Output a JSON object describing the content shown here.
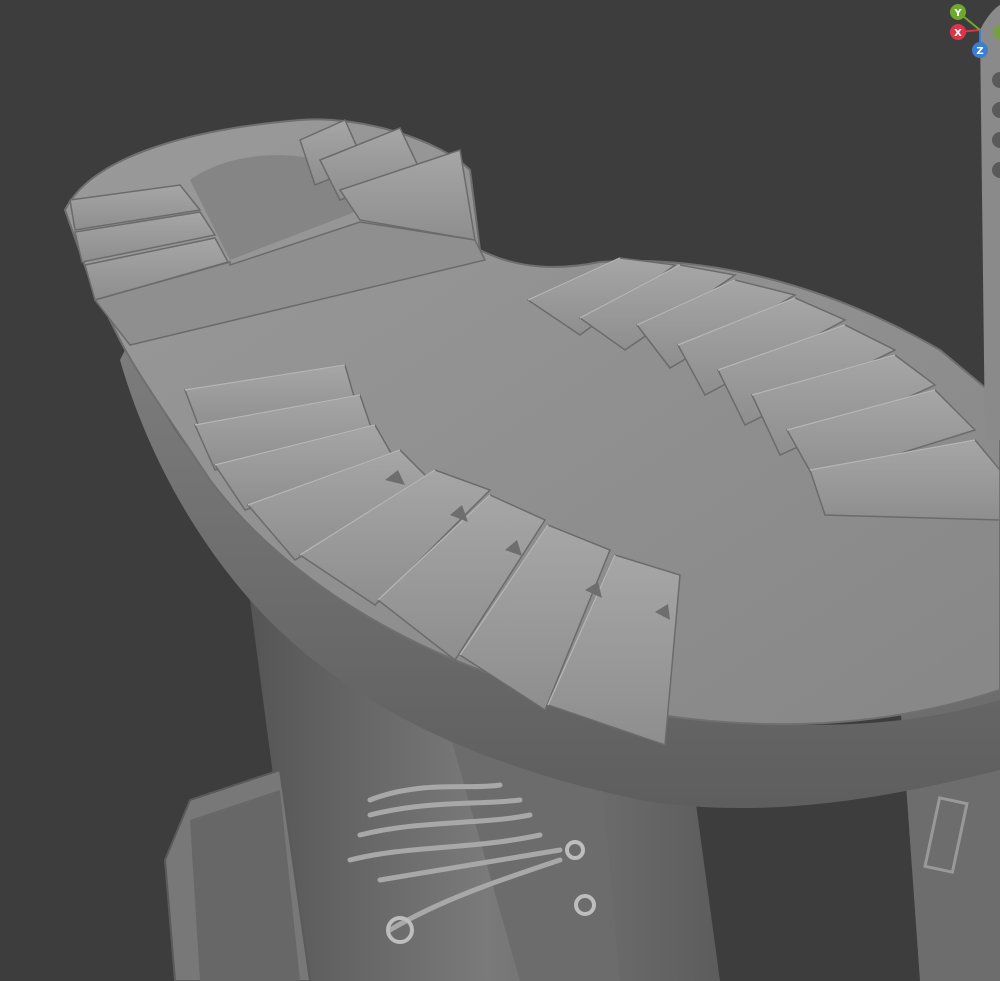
{
  "viewport": {
    "background": "#3d3d3d",
    "object": "boot-sole-sculpt",
    "material_color": "#8c8c8c"
  },
  "gizmo": {
    "axes": [
      {
        "id": "x",
        "label": "X",
        "color": "#d9364a"
      },
      {
        "id": "y",
        "label": "Y",
        "color": "#6fa82e"
      },
      {
        "id": "z",
        "label": "Z",
        "color": "#3b7ed1"
      }
    ]
  },
  "nav_strip": {
    "icons": [
      "zoom-icon",
      "pan-icon",
      "camera-icon",
      "perspective-icon"
    ]
  }
}
